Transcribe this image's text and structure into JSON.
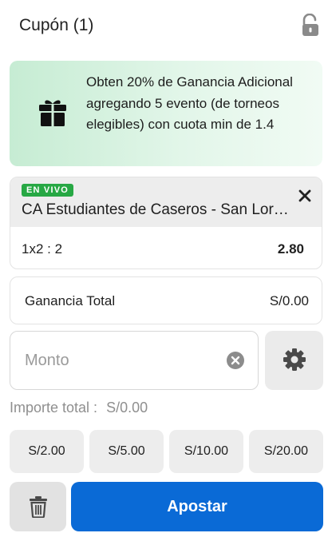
{
  "header": {
    "title": "Cupón (1)",
    "lock_icon": "unlock-icon"
  },
  "promo": {
    "icon": "gift-icon",
    "text": "Obten 20% de Ganancia Adicional agregando 5 evento (de torneos elegibles) con cuota min de 1.4"
  },
  "bet": {
    "badge": "EN VIVO",
    "event": "CA Estudiantes de Caseros - San Lorenzo",
    "market": "1x2 : 2",
    "odds": "2.80",
    "close_icon": "close-icon"
  },
  "gain": {
    "label": "Ganancia Total",
    "value": "S/0.00"
  },
  "stake": {
    "placeholder": "Monto",
    "value": ""
  },
  "total": {
    "label": "Importe total :",
    "value": "S/0.00"
  },
  "quick_amounts": [
    "S/2.00",
    "S/5.00",
    "S/10.00",
    "S/20.00"
  ],
  "actions": {
    "submit_label": "Apostar"
  },
  "colors": {
    "primary": "#0a6ad6",
    "live_badge": "#27a844",
    "promo_bg": "#d6f2df"
  }
}
